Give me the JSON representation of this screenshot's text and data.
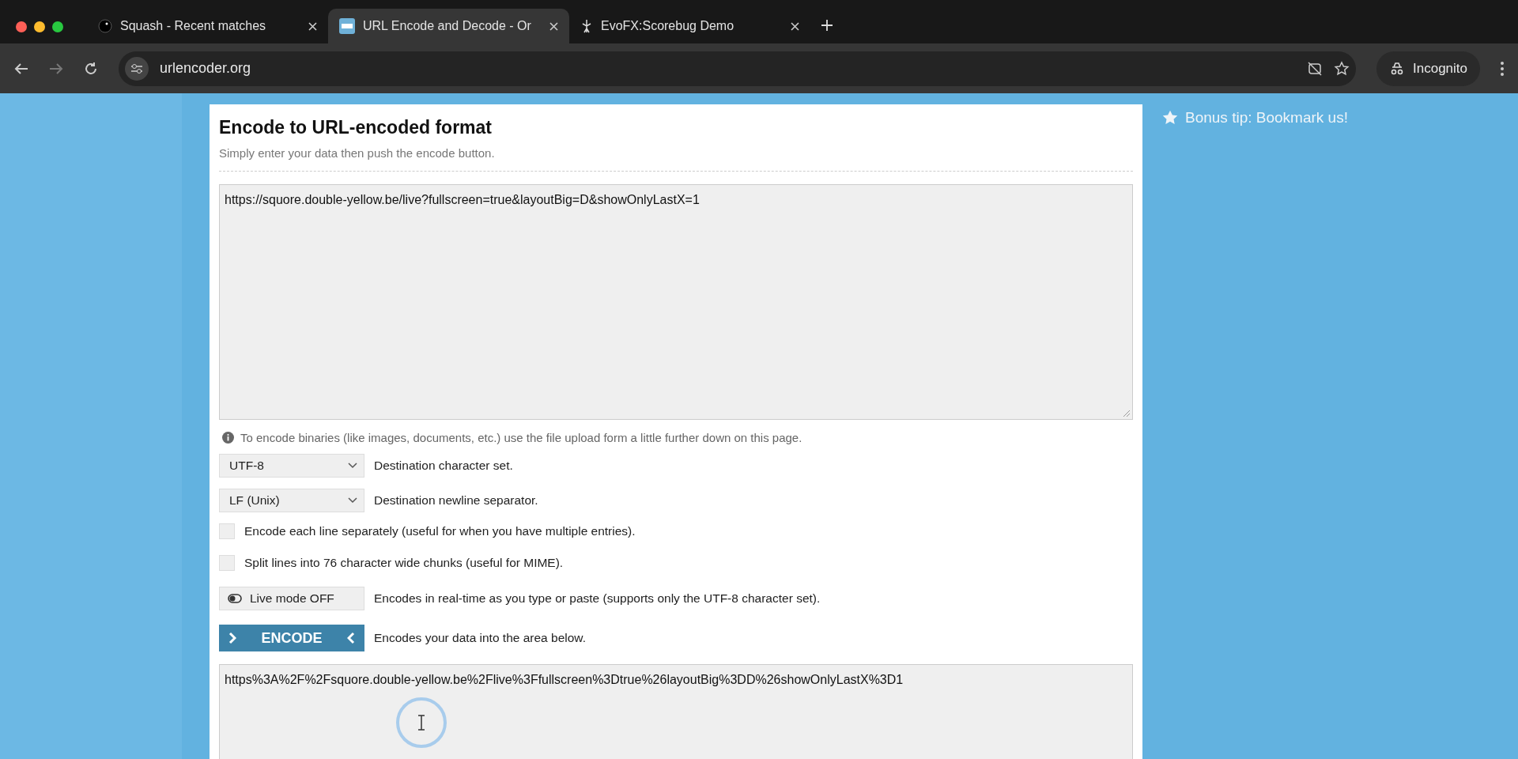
{
  "browser": {
    "tabs": [
      {
        "title": "Squash - Recent matches",
        "selected": false
      },
      {
        "title": "URL Encode and Decode - Or",
        "selected": true
      },
      {
        "title": "EvoFX:Scorebug Demo",
        "selected": false
      }
    ],
    "address": "urlencoder.org",
    "incognito_label": "Incognito"
  },
  "page": {
    "title": "Encode to URL-encoded format",
    "subtitle": "Simply enter your data then push the encode button.",
    "input_value": "https://squore.double-yellow.be/live?fullscreen=true&layoutBig=D&showOnlyLastX=1",
    "info": "To encode binaries (like images, documents, etc.) use the file upload form a little further down on this page.",
    "options": [
      {
        "kind": "select",
        "value": "UTF-8",
        "description": "Destination character set."
      },
      {
        "kind": "select",
        "value": "LF (Unix)",
        "description": "Destination newline separator."
      },
      {
        "kind": "checkbox",
        "checked": false,
        "description": "Encode each line separately (useful for when you have multiple entries)."
      },
      {
        "kind": "checkbox",
        "checked": false,
        "description": "Split lines into 76 character wide chunks (useful for MIME)."
      },
      {
        "kind": "toggle",
        "on": false,
        "button": "Live mode OFF",
        "description": "Encodes in real-time as you type or paste (supports only the UTF-8 character set)."
      },
      {
        "kind": "action",
        "button": "ENCODE",
        "description": "Encodes your data into the area below."
      }
    ],
    "output_value": "https%3A%2F%2Fsquore.double-yellow.be%2Flive%3Ffullscreen%3Dtrue%26layoutBig%3DD%26showOnlyLastX%3D1"
  },
  "sidebar": {
    "tip": "Bonus tip: Bookmark us!"
  }
}
